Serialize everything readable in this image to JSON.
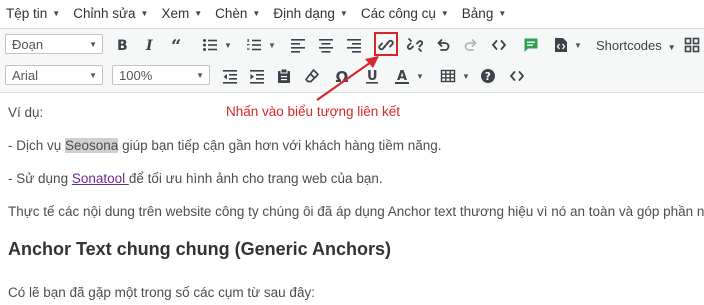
{
  "menubar": [
    "Tệp tin",
    "Chỉnh sửa",
    "Xem",
    "Chèn",
    "Định dạng",
    "Các công cụ",
    "Bảng"
  ],
  "toolbar1": {
    "format_select": "Đoạn",
    "shortcodes_label": "Shortcodes"
  },
  "toolbar2": {
    "font_select": "Arial",
    "size_select": "100%"
  },
  "annotation": "Nhấn vào biểu tượng liên kết",
  "content": {
    "p1": "Ví dụ:",
    "p2_pre": "- Dịch vụ ",
    "p2_hl": "Seosona",
    "p2_post": " giúp bạn tiếp cận gần hơn với khách hàng tiềm năng.",
    "p3_pre": "- Sử dụng ",
    "p3_link": "Sonatool ",
    "p3_post": "để tối ưu hình ảnh cho trang web của bạn.",
    "p4": "Thực tế các nội dung trên website công ty chúng ôi đã áp dụng Anchor text thương hiệu vì nó an toàn và góp phần nâng c",
    "h2": "Anchor Text chung chung (Generic Anchors)",
    "p5": "Có lẽ bạn đã gặp một trong số các cụm từ sau đây:"
  },
  "colors": {
    "accent_red": "#d9262b",
    "link_purple": "#6b2c91",
    "green_icon": "#2e9e4f"
  }
}
